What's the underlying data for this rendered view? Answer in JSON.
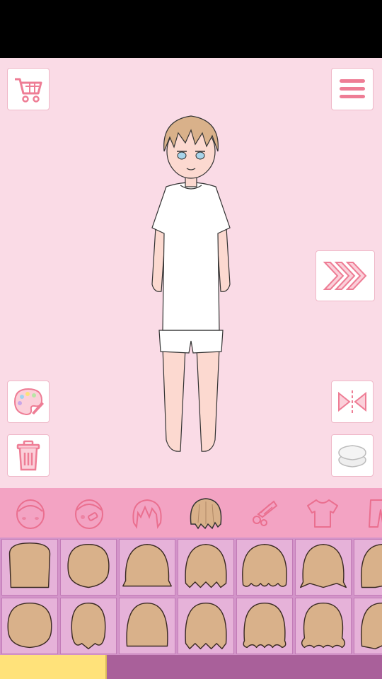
{
  "toolbar": {
    "left": [
      "cart-icon",
      "palette-icon",
      "trash-icon"
    ],
    "right": [
      "menu-icon",
      "next-icon",
      "flip-icon",
      "layers-icon"
    ]
  },
  "tabs": [
    {
      "icon": "face-icon"
    },
    {
      "icon": "face-decoration-icon"
    },
    {
      "icon": "front-hair-icon"
    },
    {
      "icon": "back-hair-icon",
      "active": true
    },
    {
      "icon": "accessory-icon"
    },
    {
      "icon": "shirt-icon"
    },
    {
      "icon": "pants-icon"
    }
  ],
  "hair_styles_row1": [
    "straight-long",
    "round-short",
    "bob-flip",
    "layered-bob",
    "wavy-medium",
    "flipped-ends",
    "side-part"
  ],
  "hair_styles_row2": [
    "round-short-b",
    "egg-short",
    "straight-medium",
    "layered-medium",
    "wavy-ends",
    "wavy-curl",
    "asym-long"
  ],
  "colors": {
    "stage_bg": "#fadbe6",
    "tab_bar": "#f3a3c3",
    "grid_bg": "#e6b2d9",
    "hair": "#d9b18a",
    "progress": "#ffe27a",
    "bottom_bar": "#a9609a"
  },
  "progress_fraction": 0.28
}
